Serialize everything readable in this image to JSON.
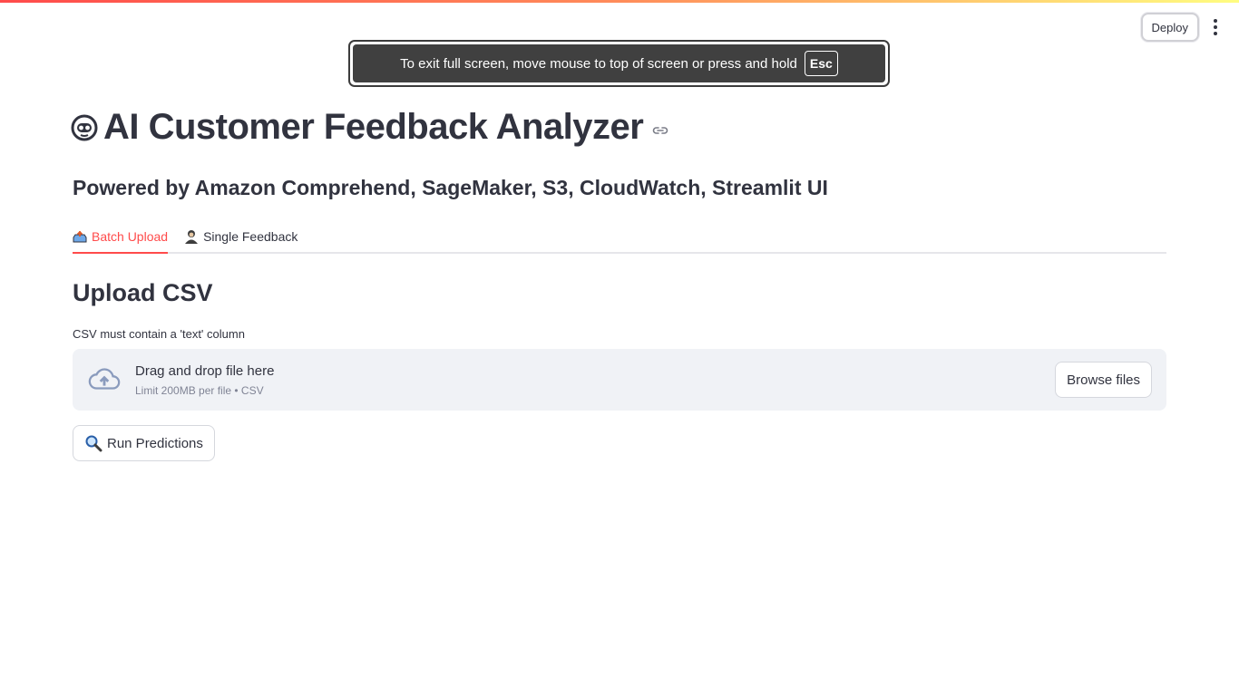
{
  "header": {
    "deploy_label": "Deploy",
    "menu_icon": "more-vertical-icon"
  },
  "fullscreen_banner": {
    "message": "To exit full screen, move mouse to top of screen or press and hold",
    "key": "Esc"
  },
  "page": {
    "title": "AI Customer Feedback Analyzer",
    "title_icon": "robot-emoji-icon",
    "subtitle": "Powered by Amazon Comprehend, SageMaker, S3, CloudWatch, Streamlit UI"
  },
  "tabs": [
    {
      "label": "Batch Upload",
      "icon": "inbox-tray-icon",
      "active": true
    },
    {
      "label": "Single Feedback",
      "icon": "person-icon",
      "active": false
    }
  ],
  "upload": {
    "heading": "Upload CSV",
    "note": "CSV must contain a 'text' column",
    "drop_text": "Drag and drop file here",
    "limit_text": "Limit 200MB per file • CSV",
    "browse_label": "Browse files"
  },
  "actions": {
    "run_label": "Run Predictions",
    "run_icon": "magnifier-icon"
  },
  "colors": {
    "accent": "#ff4b4b",
    "text": "#31333f",
    "dropzone_bg": "#f0f2f6"
  }
}
